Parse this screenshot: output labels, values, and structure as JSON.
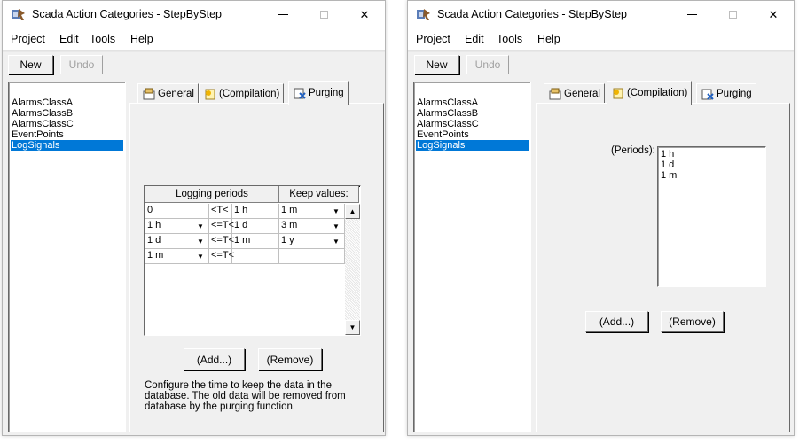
{
  "app": {
    "title": "Scada Action Categories - StepByStep",
    "close_glyph": "✕"
  },
  "menu": {
    "project": "Project",
    "edit": "Edit",
    "tools": "Tools",
    "help": "Help"
  },
  "toolbar": {
    "new_label": "New",
    "undo_label": "Undo"
  },
  "categories": [
    "AlarmsClassA",
    "AlarmsClassB",
    "AlarmsClassC",
    "EventPoints",
    "LogSignals"
  ],
  "selected_category": "LogSignals",
  "tabs": {
    "general": "General",
    "compilation": "(Compilation)",
    "purging": "Purging"
  },
  "purging": {
    "header_logging": "Logging periods",
    "header_keep": "Keep values:",
    "rows": [
      {
        "from": "0",
        "op": "<T<",
        "to": "1 h",
        "keep": "1 m"
      },
      {
        "from": "1 h",
        "op": "<=T<",
        "to": "1 d",
        "keep": "3 m"
      },
      {
        "from": "1 d",
        "op": "<=T<",
        "to": "1 m",
        "keep": "1 y"
      },
      {
        "from": "1 m",
        "op": "<=T<",
        "to": "",
        "keep": ""
      }
    ],
    "add_label": "(Add...)",
    "remove_label": "(Remove)",
    "description": "Configure the time to keep the data in the database. The old data will be removed from database by the purging function."
  },
  "compilation": {
    "periods_label": "(Periods):",
    "periods": [
      "1 h",
      "1 d",
      "1 m"
    ],
    "add_label": "(Add...)",
    "remove_label": "(Remove)"
  },
  "colors": {
    "selection": "#0078d7",
    "face": "#f0f0f0"
  }
}
